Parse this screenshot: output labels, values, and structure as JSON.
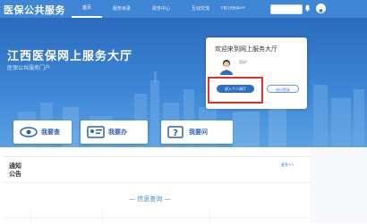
{
  "header": {
    "brand": "医保公共服务",
    "nav": [
      "首页",
      "服务目录",
      "政务中心",
      "互动交流"
    ],
    "app_link": "下载江西医保APP"
  },
  "banner": {
    "title": "江西医保网上服务大厅",
    "subtitle": "医保公共服务门户"
  },
  "login_card": {
    "welcome": "欢迎来到网上服务大厅",
    "user_line1": "您好!",
    "user_line2": "",
    "enter_button": "进入个人网厅",
    "logout_button": "退出登录"
  },
  "quick_links": [
    {
      "label": "我要查",
      "icon": "eye-icon"
    },
    {
      "label": "我要办",
      "icon": "id-card-icon"
    },
    {
      "label": "我要问",
      "icon": "question-icon"
    }
  ],
  "notice": {
    "title": "通知公告",
    "more": "更多>>",
    "info_query": "— 信息查询 —"
  },
  "colors": {
    "primary": "#3f86d4",
    "highlight": "#e0342b",
    "accent": "#2d62b1"
  }
}
